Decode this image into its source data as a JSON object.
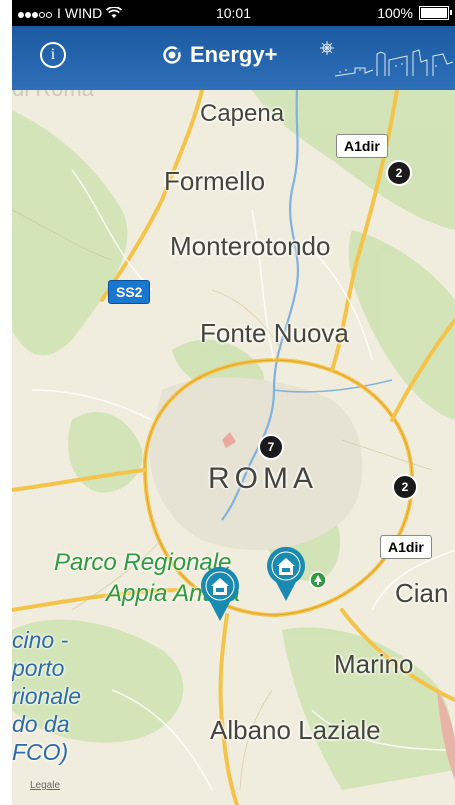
{
  "status_bar": {
    "carrier": "WIND",
    "signal_separator": "I",
    "time": "10:01",
    "battery": "100%",
    "battery_level": 1.0,
    "signal_dots_filled": 3,
    "signal_dots_total": 5
  },
  "nav": {
    "info_label": "i",
    "app_title": "Energy+",
    "overlay_text": "di Roma"
  },
  "map": {
    "places": {
      "capena": "Capena",
      "formello": "Formello",
      "monterotondo": "Monterotondo",
      "fonte_nuova": "Fonte Nuova",
      "roma": "ROMA",
      "ciampino": "Cian",
      "marino": "Marino",
      "albano": "Albano Laziale"
    },
    "park": {
      "line1": "Parco Regionale",
      "line2": "Appia Antica"
    },
    "airport": {
      "line1": "cino -",
      "line2": "porto",
      "line3": "rionale",
      "line4": "do da",
      "line5": "FCO)"
    },
    "roads": {
      "a1dir_top": "A1dir",
      "ss2": "SS2",
      "a1dir_bottom": "A1dir"
    },
    "clusters": {
      "north": "2",
      "center": "7",
      "east": "2"
    },
    "legal": "Legale"
  },
  "colors": {
    "nav_blue": "#1c5aa0",
    "map_bg": "#f1edde",
    "marker_teal": "#1b8ab0",
    "park_green": "#2f9a3e",
    "highway": "#f4c34a",
    "river": "#7fb2e0"
  },
  "icons": {
    "info": "info-icon",
    "brand": "energy-plus-logo-icon",
    "wifi": "wifi-icon",
    "battery": "battery-icon",
    "marker": "charging-station-pin-icon"
  }
}
